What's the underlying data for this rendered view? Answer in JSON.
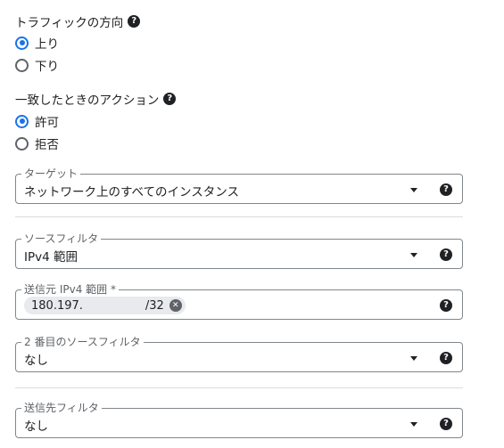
{
  "traffic_direction": {
    "title": "トラフィックの方向",
    "options": [
      {
        "label": "上り",
        "checked": true
      },
      {
        "label": "下り",
        "checked": false
      }
    ]
  },
  "match_action": {
    "title": "一致したときのアクション",
    "options": [
      {
        "label": "許可",
        "checked": true
      },
      {
        "label": "拒否",
        "checked": false
      }
    ]
  },
  "target": {
    "label": "ターゲット",
    "value": "ネットワーク上のすべてのインスタンス"
  },
  "source_filter": {
    "label": "ソースフィルタ",
    "value": "IPv4 範囲"
  },
  "source_ipv4": {
    "label": "送信元 IPv4 範囲 *",
    "chip_prefix": "180.197.",
    "chip_suffix": "/32"
  },
  "second_source_filter": {
    "label": "2 番目のソースフィルタ",
    "value": "なし"
  },
  "destination_filter": {
    "label": "送信先フィルタ",
    "value": "なし"
  },
  "icons": {
    "help": "?",
    "chip_remove": "✕"
  },
  "colors": {
    "accent": "#1a73e8",
    "text": "#202124",
    "border": "#80868b"
  }
}
